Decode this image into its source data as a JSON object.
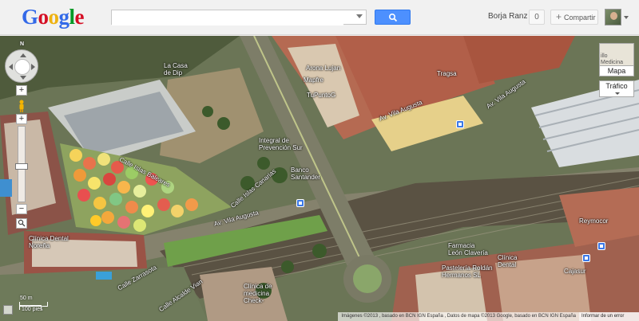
{
  "header": {
    "logo": [
      "G",
      "o",
      "o",
      "g",
      "l",
      "e"
    ],
    "logo_colors": [
      "#3369e8",
      "#d50f25",
      "#eeb211",
      "#3369e8",
      "#009925",
      "#d50f25"
    ],
    "search_value": "",
    "user_name": "Borja Ranz",
    "notifications": "0",
    "share_label": "Compartir",
    "share_plus": "+"
  },
  "map": {
    "controls": {
      "north_label": "N",
      "zoom_in": "+",
      "zoom_out": "−",
      "scale_top": "50 m",
      "scale_bottom": "100 pies",
      "map_type_label": "Mapa",
      "map_thumb_text": "illo\nMedicina",
      "traffic_label": "Tráfico"
    },
    "labels": {
      "la_casa_de_dip": "La Casa\nde Dip",
      "arona_lujan": "Arona Lujan",
      "mapfre": "Mapfre",
      "tupunto": "TuPuntoG",
      "tragsa": "Tragsa",
      "integral": "Integral de\nPrevención Sur",
      "banco_santander": "Banco\nSantander",
      "calle_islas_baleares": "Calle Islas Baleares",
      "calle_islas_canarias": "Calle Islas Canarias",
      "av_vila_auqusta_1": "Av. Vila Augusta",
      "av_vila_auqusta_2": "Av. Vila Augusta",
      "av_vila_auqusta_3": "Av. Vila Augusta",
      "clinica_dental_norena": "Clínica Dental\nNoreña",
      "farmacia": "Farmacia\nLeón Clavería",
      "clinica_dental_2": "Clínica\nDental",
      "pasteleria": "Pastelería Roldán\nHermanos SL",
      "reymocor": "Reymocor",
      "cajasur": "Cajasur",
      "calle_zarrasota": "Calle Zarrasota",
      "calle_alcalde": "Calle Alcalde Vian",
      "clinica_check": "Clínica de\nmedicina\nCheck-"
    },
    "footer_attribution": "Imágenes ©2013 , basado en BCN IGN España , Datos de mapa ©2013 Google, basado en BCN IGN España",
    "footer_error": "Informar de un error"
  }
}
